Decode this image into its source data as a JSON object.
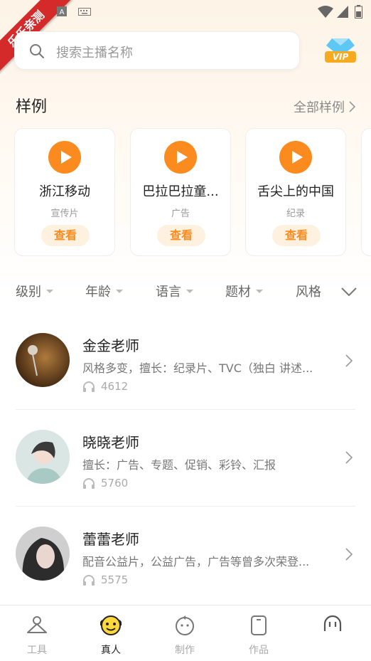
{
  "statusbar": {
    "ribbon_text": "乐乐亲测"
  },
  "search": {
    "placeholder": "搜索主播名称"
  },
  "vip": {
    "label": "VIP"
  },
  "samples": {
    "title": "样例",
    "more_label": "全部样例",
    "items": [
      {
        "name": "浙江移动",
        "type": "宣传片",
        "button": "查看"
      },
      {
        "name": "巴拉巴拉童...",
        "type": "广告",
        "button": "查看"
      },
      {
        "name": "舌尖上的中国",
        "type": "纪录",
        "button": "查看"
      }
    ]
  },
  "filters": [
    {
      "label": "级别"
    },
    {
      "label": "年龄"
    },
    {
      "label": "语言"
    },
    {
      "label": "题材"
    },
    {
      "label": "风格"
    }
  ],
  "teachers": [
    {
      "name": "金金老师",
      "desc": "风格多变，擅长：纪录片、TVC（独白 讲述...",
      "plays": "4612"
    },
    {
      "name": "晓晓老师",
      "desc": "擅长：广告、专题、促销、彩铃、汇报",
      "plays": "5760"
    },
    {
      "name": "蕾蕾老师",
      "desc": "配音公益片，公益广告，广告等曾多次荣登...",
      "plays": "5575"
    }
  ],
  "tabbar": {
    "tabs": [
      {
        "label": "工具",
        "icon": "hanger-icon"
      },
      {
        "label": "真人",
        "icon": "face-icon"
      },
      {
        "label": "制作",
        "icon": "refresh-face-icon"
      },
      {
        "label": "作品",
        "icon": "phone-icon"
      },
      {
        "label": "",
        "icon": "ghost-icon"
      }
    ]
  },
  "colors": {
    "accent": "#fb8b1e",
    "accent_light": "#fff1e0",
    "active_tab_icon": "#ffd93b"
  }
}
